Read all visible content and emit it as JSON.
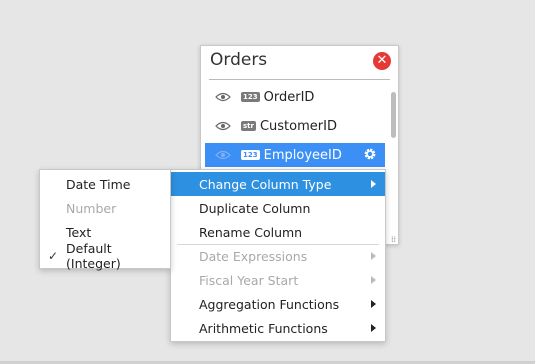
{
  "panel": {
    "title": "Orders",
    "close_icon": "close-icon",
    "fields": [
      {
        "badge": "123",
        "name": "OrderID",
        "selected": false
      },
      {
        "badge": "str",
        "name": "CustomerID",
        "selected": false
      },
      {
        "badge": "123",
        "name": "EmployeeID",
        "selected": true
      }
    ]
  },
  "context_menu": {
    "items": [
      {
        "label": "Change Column Type",
        "active": true,
        "submenu": true,
        "disabled": false
      },
      {
        "label": "Duplicate Column",
        "active": false,
        "submenu": false,
        "disabled": false
      },
      {
        "label": "Rename Column",
        "active": false,
        "submenu": false,
        "disabled": false
      },
      {
        "label": "Date Expressions",
        "active": false,
        "submenu": true,
        "disabled": true
      },
      {
        "label": "Fiscal Year Start",
        "active": false,
        "submenu": true,
        "disabled": true
      },
      {
        "label": "Aggregation Functions",
        "active": false,
        "submenu": true,
        "disabled": false
      },
      {
        "label": "Arithmetic Functions",
        "active": false,
        "submenu": true,
        "disabled": false
      }
    ]
  },
  "type_submenu": {
    "items": [
      {
        "label": "Date Time",
        "checked": false,
        "disabled": false
      },
      {
        "label": "Number",
        "checked": false,
        "disabled": true
      },
      {
        "label": "Text",
        "checked": false,
        "disabled": false
      },
      {
        "label": "Default (Integer)",
        "checked": true,
        "disabled": false
      }
    ],
    "check_mark": "✓"
  },
  "colors": {
    "selected_field": "#3c8ff5",
    "active_menu_item": "#2e90e0",
    "close_button": "#e53935"
  }
}
